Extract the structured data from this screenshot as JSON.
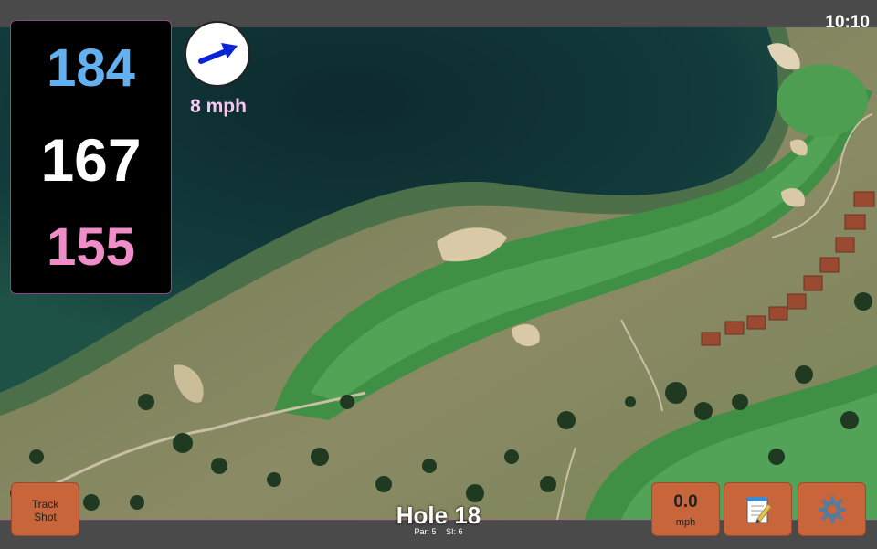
{
  "status": {
    "time": "10:10"
  },
  "distances": {
    "back": "184",
    "middle": "167",
    "front": "155",
    "colors": {
      "back": "#63b0f0",
      "middle": "#ffffff",
      "front": "#f08cc8"
    }
  },
  "wind": {
    "speed": "8 mph",
    "arrow_icon": "wind-arrow-icon",
    "arrow_color": "#0a22d8",
    "text_color": "#f6c8f0"
  },
  "buttons": {
    "track_shot_line1": "Track",
    "track_shot_line2": "Shot",
    "speed_value": "0.0",
    "speed_unit": "mph",
    "notes_icon": "notepad-icon",
    "settings_icon": "gear-icon",
    "accent": "#c8653a"
  },
  "hole": {
    "title": "Hole 18",
    "par": "Par: 5",
    "si": "SI: 6"
  }
}
